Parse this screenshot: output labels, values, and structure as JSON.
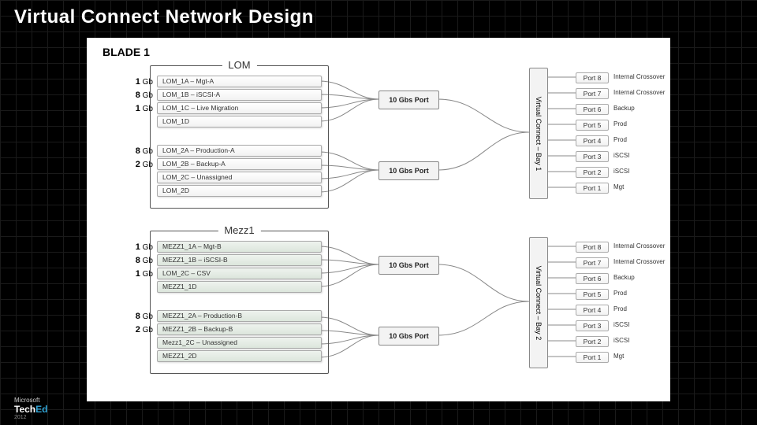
{
  "slide": {
    "title": "Virtual Connect Network Design",
    "blade_label": "BLADE 1"
  },
  "nics": [
    {
      "title": "LOM",
      "mezz": false,
      "groups": [
        {
          "ports": [
            {
              "bw": "1",
              "label": "LOM_1A – Mgt-A"
            },
            {
              "bw": "8",
              "label": "LOM_1B – iSCSI-A"
            },
            {
              "bw": "1",
              "label": "LOM_1C – Live Migration"
            },
            {
              "bw": "",
              "label": "LOM_1D"
            }
          ],
          "agg": "10 Gbs Port"
        },
        {
          "ports": [
            {
              "bw": "8",
              "label": "LOM_2A – Production-A"
            },
            {
              "bw": "2",
              "label": "LOM_2B – Backup-A"
            },
            {
              "bw": "",
              "label": "LOM_2C – Unassigned"
            },
            {
              "bw": "",
              "label": "LOM_2D"
            }
          ],
          "agg": "10 Gbs Port"
        }
      ]
    },
    {
      "title": "Mezz1",
      "mezz": true,
      "groups": [
        {
          "ports": [
            {
              "bw": "1",
              "label": "MEZZ1_1A – Mgt-B"
            },
            {
              "bw": "8",
              "label": "MEZZ1_1B – iSCSI-B"
            },
            {
              "bw": "1",
              "label": "LOM_2C – CSV"
            },
            {
              "bw": "",
              "label": "MEZZ1_1D"
            }
          ],
          "agg": "10 Gbs Port"
        },
        {
          "ports": [
            {
              "bw": "8",
              "label": "MEZZ1_2A – Production-B"
            },
            {
              "bw": "2",
              "label": "MEZZ1_2B – Backup-B"
            },
            {
              "bw": "",
              "label": "Mezz1_2C – Unassigned"
            },
            {
              "bw": "",
              "label": "MEZZ1_2D"
            }
          ],
          "agg": "10 Gbs Port"
        }
      ]
    }
  ],
  "bw_unit": "Gb",
  "vc_modules": [
    {
      "label": "Virtual Connect – Bay 1"
    },
    {
      "label": "Virtual Connect – Bay 2"
    }
  ],
  "ext_ports": [
    {
      "items": [
        {
          "name": "Port 8",
          "uplink": "Internal Crossover"
        },
        {
          "name": "Port 7",
          "uplink": "Internal Crossover"
        },
        {
          "name": "Port 6",
          "uplink": "Backup"
        },
        {
          "name": "Port 5",
          "uplink": "Prod"
        },
        {
          "name": "Port 4",
          "uplink": "Prod"
        },
        {
          "name": "Port 3",
          "uplink": "iSCSI"
        },
        {
          "name": "Port 2",
          "uplink": "iSCSI"
        },
        {
          "name": "Port 1",
          "uplink": "Mgt"
        }
      ]
    },
    {
      "items": [
        {
          "name": "Port 8",
          "uplink": "Internal Crossover"
        },
        {
          "name": "Port 7",
          "uplink": "Internal Crossover"
        },
        {
          "name": "Port 6",
          "uplink": "Backup"
        },
        {
          "name": "Port 5",
          "uplink": "Prod"
        },
        {
          "name": "Port 4",
          "uplink": "Prod"
        },
        {
          "name": "Port 3",
          "uplink": "iSCSI"
        },
        {
          "name": "Port 2",
          "uplink": "iSCSI"
        },
        {
          "name": "Port 1",
          "uplink": "Mgt"
        }
      ]
    }
  ],
  "footer": {
    "brand1": "Microsoft",
    "brand2a": "Tech",
    "brand2b": "Ed",
    "year": "2012"
  }
}
